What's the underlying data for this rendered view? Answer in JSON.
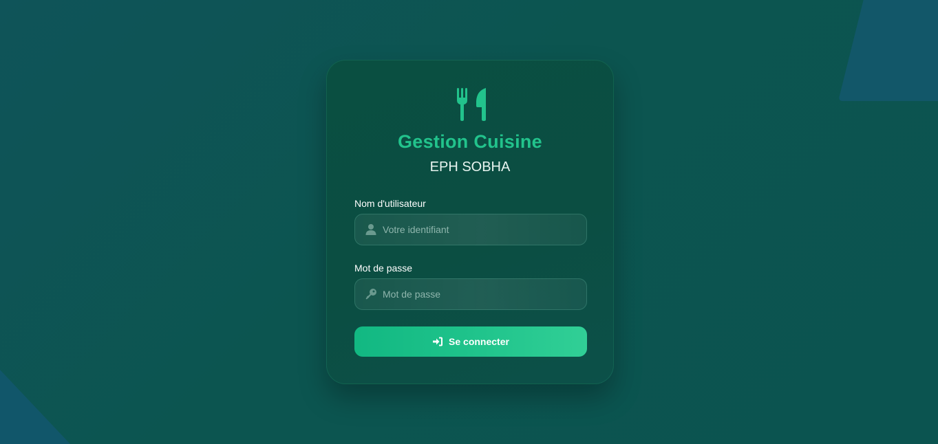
{
  "app": {
    "title": "Gestion Cuisine",
    "subtitle": "EPH SOBHA",
    "logo_icon": "utensils-icon",
    "accent_color": "#22c38c"
  },
  "form": {
    "username": {
      "label": "Nom d'utilisateur",
      "placeholder": "Votre identifiant",
      "value": "",
      "icon": "user-icon"
    },
    "password": {
      "label": "Mot de passe",
      "placeholder": "Mot de passe",
      "value": "",
      "icon": "key-icon"
    },
    "submit": {
      "label": "Se connecter",
      "icon": "sign-in-icon",
      "color": "#1fc38b"
    }
  }
}
